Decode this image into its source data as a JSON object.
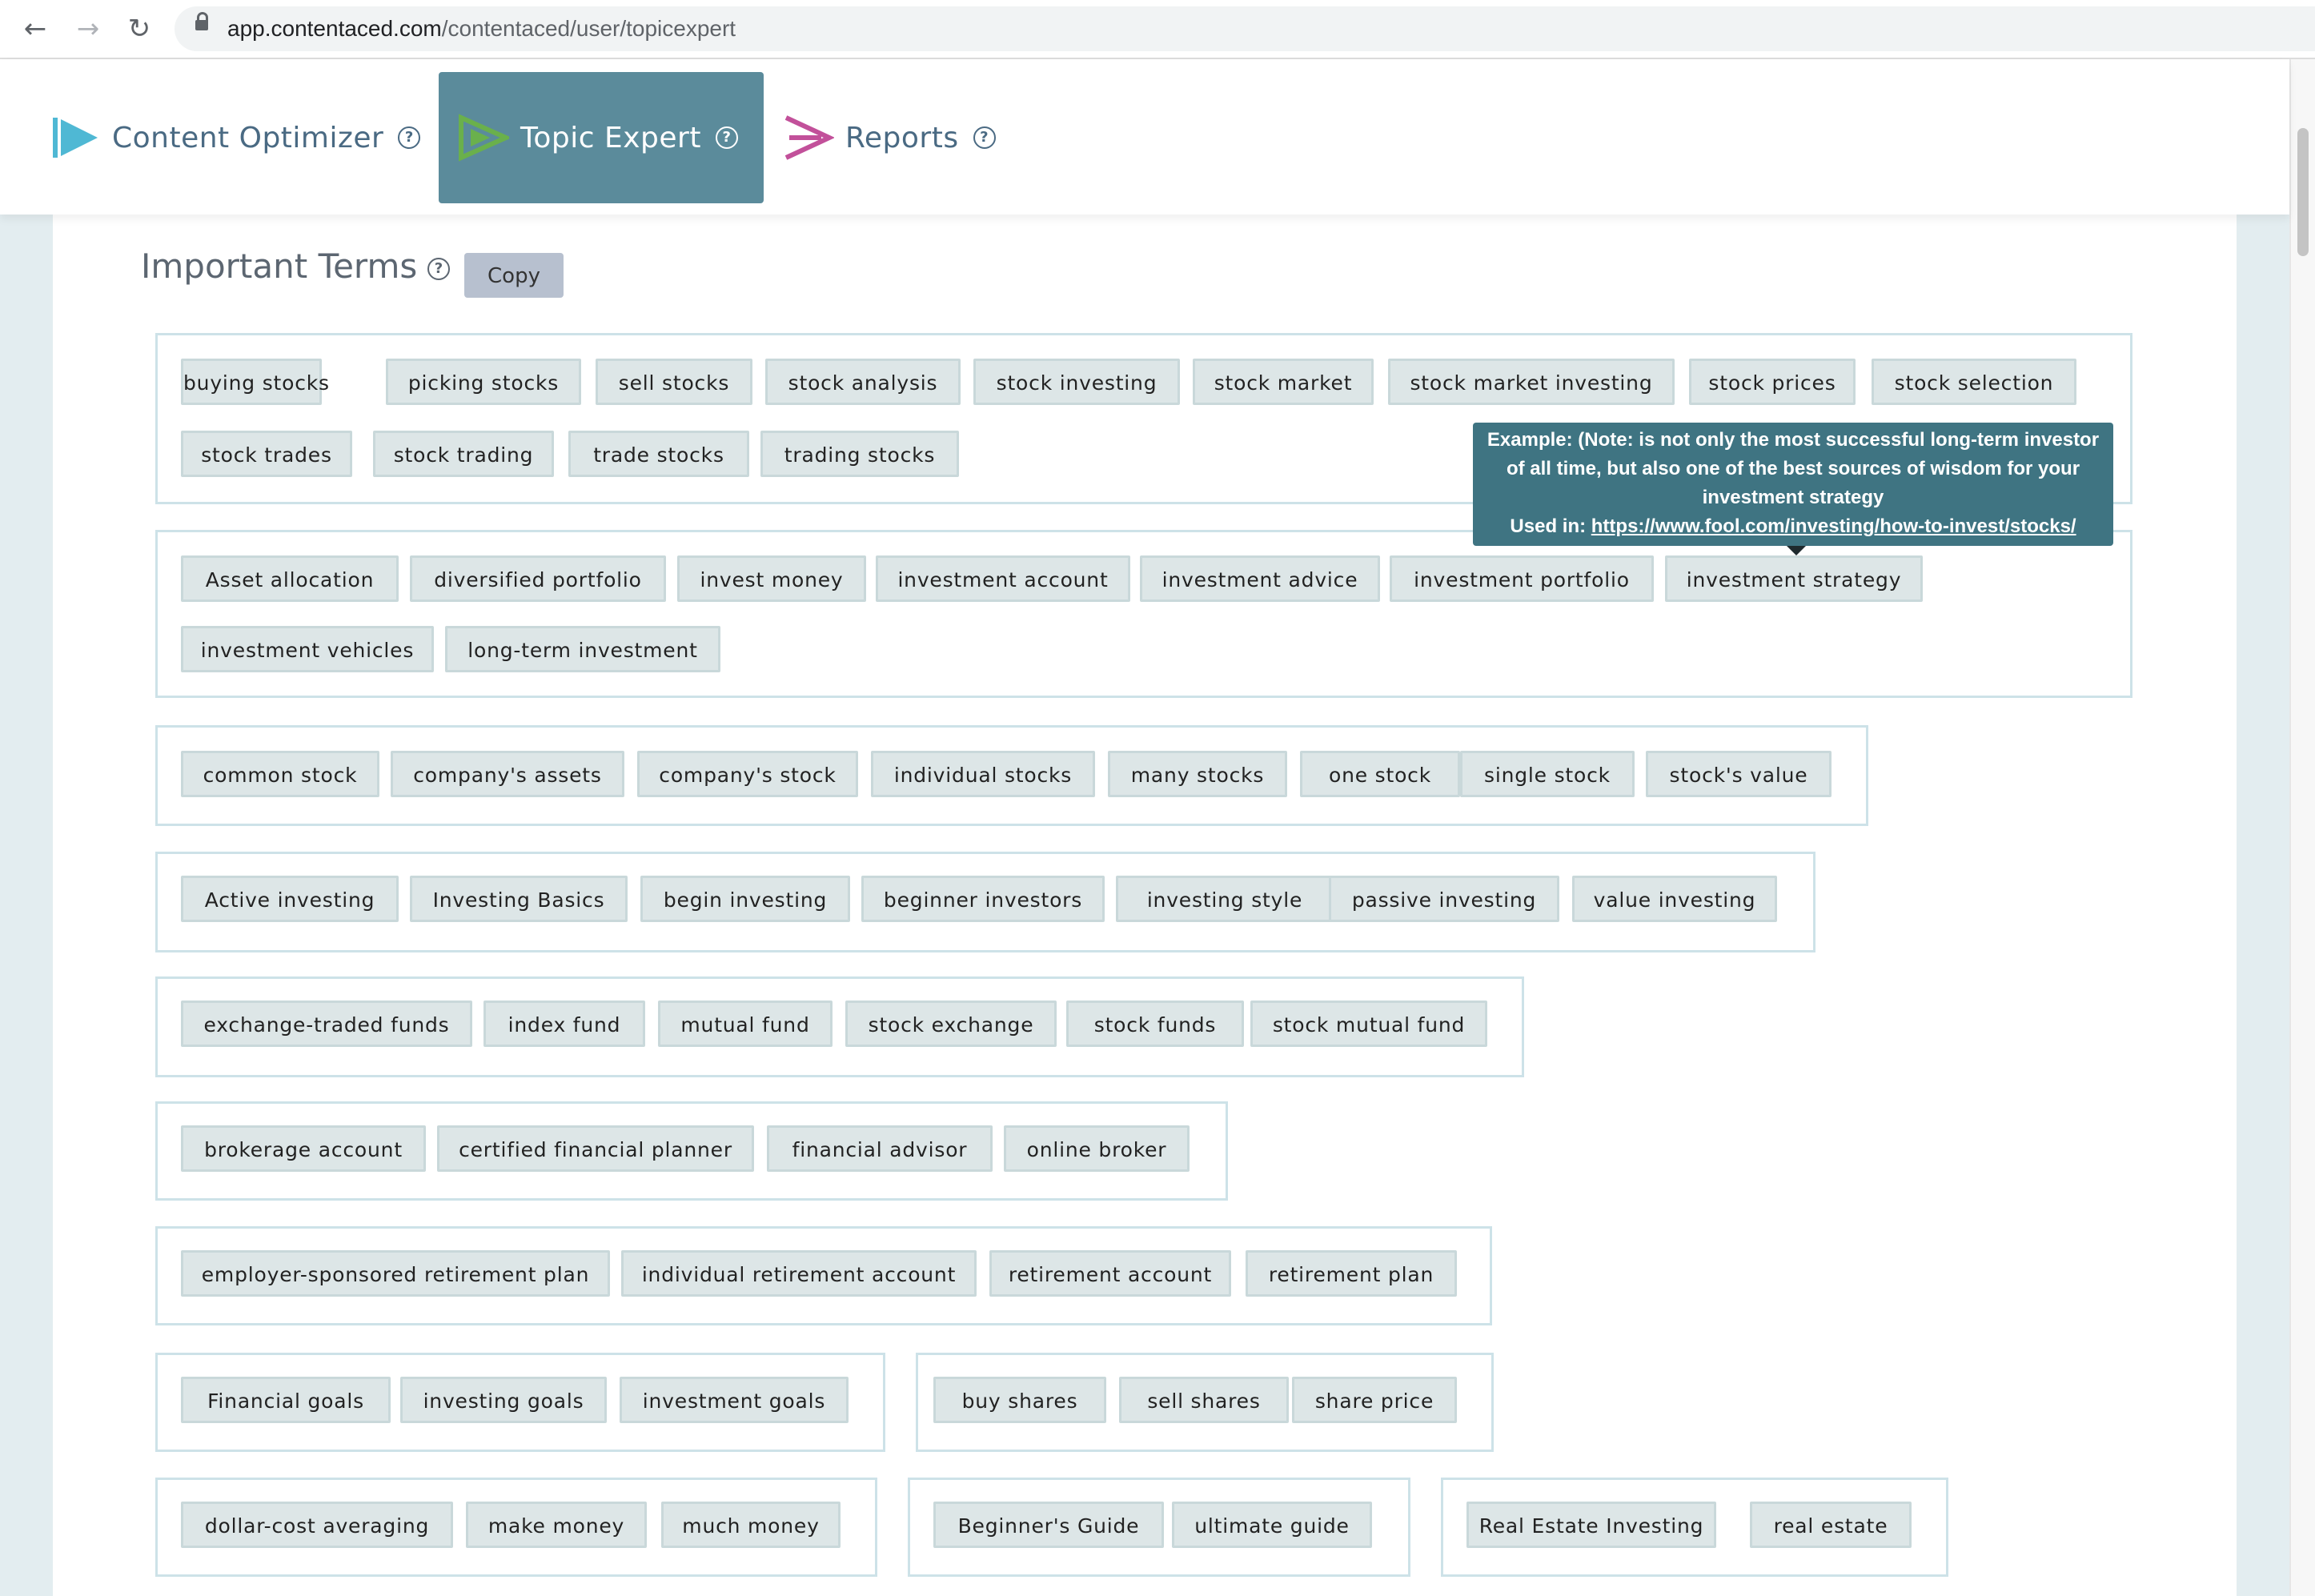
{
  "browser": {
    "url_host": "app.contentaced.com",
    "url_path": "/contentaced/user/topicexpert",
    "back_icon": "arrow-left-icon",
    "forward_icon": "arrow-right-icon",
    "reload_icon": "reload-icon"
  },
  "header": {
    "tabs": [
      {
        "label": "Content Optimizer",
        "icon": "content-optimizer-logo",
        "color": "#4fb8d4",
        "active": false
      },
      {
        "label": "Topic Expert",
        "icon": "topic-expert-logo",
        "color": "#6ab04c",
        "active": true
      },
      {
        "label": "Reports",
        "icon": "reports-logo",
        "color": "#c2509a",
        "active": false
      }
    ],
    "help_glyph": "?"
  },
  "section": {
    "title": "Important Terms",
    "copy_label": "Copy"
  },
  "groups": [
    {
      "terms": [
        "buying stocks",
        "picking stocks",
        "sell stocks",
        "stock analysis",
        "stock investing",
        "stock market",
        "stock market investing",
        "stock prices",
        "stock selection",
        "stock trades",
        "stock trading",
        "trade stocks",
        "trading stocks"
      ]
    },
    {
      "terms": [
        "Asset allocation",
        "diversified portfolio",
        "invest money",
        "investment account",
        "investment advice",
        "investment portfolio",
        "investment strategy",
        "investment vehicles",
        "long-term investment"
      ]
    },
    {
      "terms": [
        "common stock",
        "company's assets",
        "company's stock",
        "individual stocks",
        "many stocks",
        "one stock",
        "single stock",
        "stock's value"
      ]
    },
    {
      "terms": [
        "Active investing",
        "Investing Basics",
        "begin investing",
        "beginner investors",
        "investing style",
        "passive investing",
        "value investing"
      ]
    },
    {
      "terms": [
        "exchange-traded funds",
        "index fund",
        "mutual fund",
        "stock exchange",
        "stock funds",
        "stock mutual fund"
      ]
    },
    {
      "terms": [
        "brokerage account",
        "certified financial planner",
        "financial advisor",
        "online broker"
      ]
    },
    {
      "terms": [
        "employer-sponsored retirement plan",
        "individual retirement account",
        "retirement account",
        "retirement plan"
      ]
    },
    {
      "terms": [
        "Financial goals",
        "investing goals",
        "investment goals"
      ]
    },
    {
      "terms": [
        "buy shares",
        "sell shares",
        "share price"
      ]
    },
    {
      "terms": [
        "dollar-cost averaging",
        "make money",
        "much money"
      ]
    },
    {
      "terms": [
        "Beginner's Guide",
        "ultimate guide"
      ]
    },
    {
      "terms": [
        "Real Estate Investing",
        "real estate"
      ]
    }
  ],
  "tooltip": {
    "line1": "Example: (Note: is not only the most successful long-term investor",
    "line2": "of all time, but also one of the best sources of wisdom for your",
    "line3": "investment strategy",
    "used_in_label": "Used in: ",
    "used_in_url": "https://www.fool.com/investing/how-to-invest/stocks/"
  },
  "colors": {
    "active_tab_bg": "#5b8b9b",
    "chip_bg": "#dde6e7",
    "group_border": "#cde2e8",
    "tooltip_bg": "#3f7482"
  }
}
